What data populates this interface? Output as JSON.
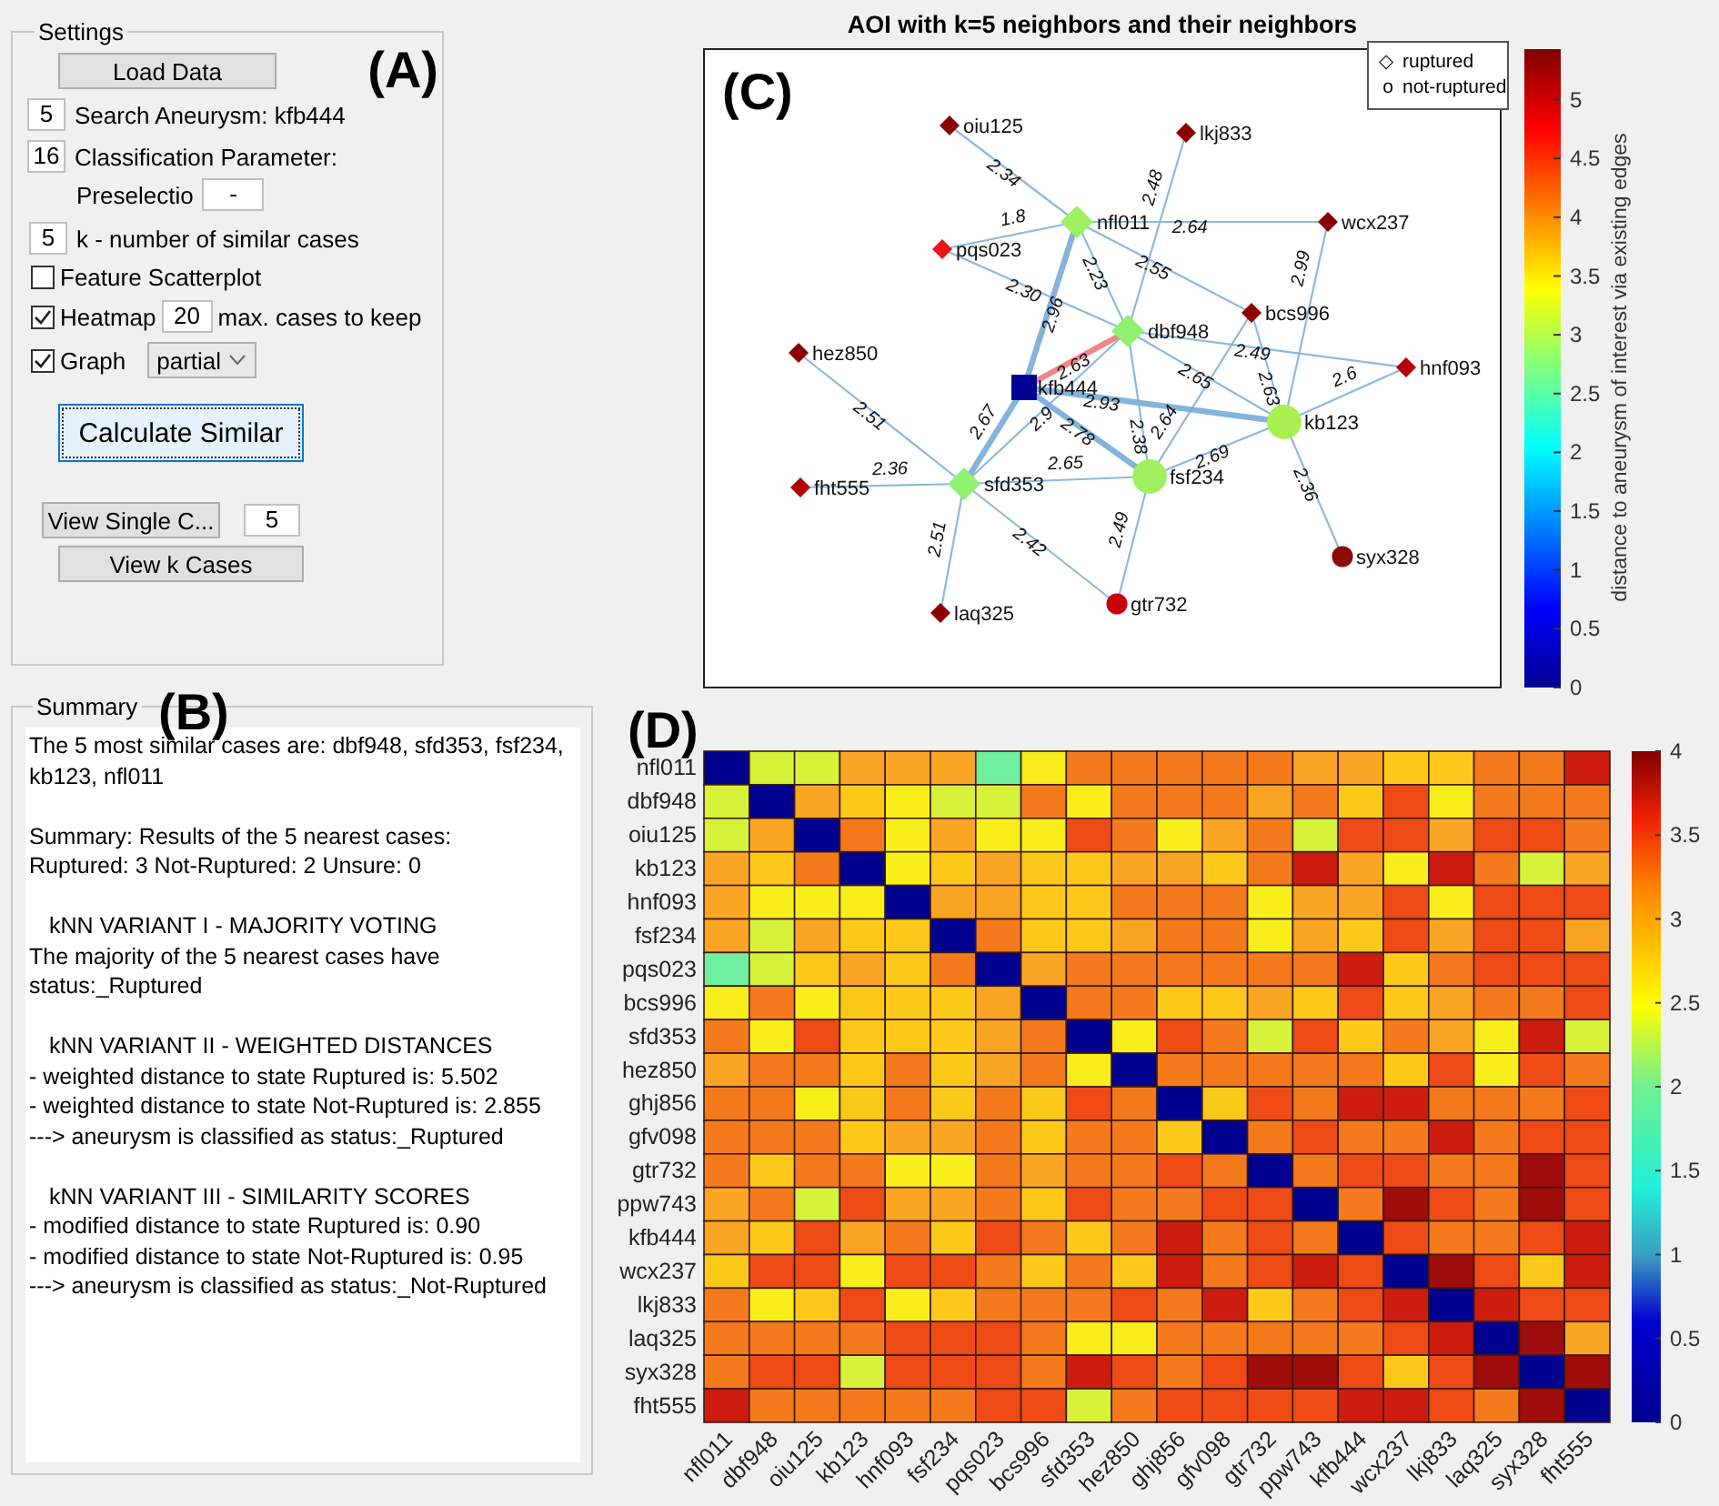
{
  "settings": {
    "title": "Settings",
    "tag": "(A)",
    "load_button": "Load Data",
    "search": {
      "value": "5",
      "label": "Search Aneurysm: kfb444"
    },
    "classification": {
      "value": "16",
      "label": "Classification Parameter:",
      "sublabel": "Preselectio",
      "subvalue": "-"
    },
    "k": {
      "value": "5",
      "label": "k - number of similar cases"
    },
    "feature_scatterplot": {
      "label": "Feature Scatterplot",
      "checked": false
    },
    "heatmap": {
      "label": "Heatmap",
      "checked": true,
      "value": "20",
      "suffix": "max. cases to keep"
    },
    "graph": {
      "label": "Graph",
      "checked": true,
      "mode": "partial"
    },
    "calculate_button": {
      "label": "Calculate Similar",
      "focused": true
    },
    "view_single": {
      "label": "View Single C...",
      "value": "5"
    },
    "view_k_button": "View k Cases"
  },
  "summary": {
    "title": "Summary",
    "tag": "(B)",
    "paragraphs": [
      [
        {
          "kind": "line",
          "text": "The 5 most similar cases are: dbf948, sfd353, fsf234, kb123, nfl011"
        }
      ],
      [
        {
          "kind": "line",
          "text": "Summary: Results of the 5 nearest cases:"
        },
        {
          "kind": "line",
          "text": "Ruptured: 3  Not-Ruptured: 2  Unsure: 0"
        }
      ],
      [
        {
          "kind": "heading",
          "text": "kNN VARIANT I - MAJORITY VOTING"
        },
        {
          "kind": "line",
          "text": "The majority of the 5 nearest cases have"
        },
        {
          "kind": "line",
          "text": "status:_Ruptured"
        }
      ],
      [
        {
          "kind": "heading",
          "text": "kNN VARIANT II - WEIGHTED DISTANCES"
        },
        {
          "kind": "line",
          "text": "- weighted distance to state Ruptured is: 5.502"
        },
        {
          "kind": "line",
          "text": "- weighted distance to state Not-Ruptured is: 2.855"
        },
        {
          "kind": "line",
          "text": "---> aneurysm is classified as status:_Ruptured"
        }
      ],
      [
        {
          "kind": "heading",
          "text": "kNN VARIANT III - SIMILARITY SCORES"
        },
        {
          "kind": "line",
          "text": "- modified distance to state Ruptured is: 0.90"
        },
        {
          "kind": "line",
          "text": "- modified distance to state Not-Ruptured is: 0.95"
        },
        {
          "kind": "line",
          "text": "---> aneurysm is classified as status:_Not-Ruptured"
        }
      ]
    ]
  },
  "graph": {
    "title": "AOI with k=5 neighbors and their neighbors",
    "tag": "(C)",
    "legend": [
      {
        "symbol": "◇",
        "label": "ruptured"
      },
      {
        "symbol": "o",
        "label": "not-ruptured"
      }
    ],
    "nodes": [
      {
        "label": "oiu125",
        "kind": "diamond",
        "color": "#8b0000"
      },
      {
        "label": "lkj833",
        "kind": "diamond",
        "color": "#8b0000"
      },
      {
        "label": "nfl011",
        "kind": "diamond",
        "color": "#9ef060"
      },
      {
        "label": "wcx237",
        "kind": "diamond",
        "color": "#8b0000"
      },
      {
        "label": "pqs023",
        "kind": "diamond",
        "color": "#e81818"
      },
      {
        "label": "dbf948",
        "kind": "diamond",
        "color": "#90f070"
      },
      {
        "label": "bcs996",
        "kind": "diamond",
        "color": "#8b0000"
      },
      {
        "label": "hez850",
        "kind": "diamond",
        "color": "#8b0000"
      },
      {
        "label": "hnf093",
        "kind": "diamond",
        "color": "#b00008"
      },
      {
        "label": "kfb444",
        "kind": "square",
        "color": "#000090"
      },
      {
        "label": "kb123",
        "kind": "circle",
        "color": "#a8f050"
      },
      {
        "label": "sfd353",
        "kind": "diamond",
        "color": "#90f070"
      },
      {
        "label": "fsf234",
        "kind": "circle",
        "color": "#a0f060"
      },
      {
        "label": "fht555",
        "kind": "diamond",
        "color": "#b00008"
      },
      {
        "label": "syx328",
        "kind": "circle",
        "color": "#8b0a0a"
      },
      {
        "label": "laq325",
        "kind": "diamond",
        "color": "#8b0000"
      },
      {
        "label": "gtr732",
        "kind": "circle",
        "color": "#c8000c"
      }
    ],
    "edges": [
      {
        "label": "2.34",
        "kind": "thin"
      },
      {
        "label": "1.8",
        "kind": "thin"
      },
      {
        "label": "2.64",
        "kind": "thin"
      },
      {
        "label": "2.48",
        "kind": "thin"
      },
      {
        "label": "2.55",
        "kind": "thin"
      },
      {
        "label": "2.23",
        "kind": "thin"
      },
      {
        "label": "2.30",
        "kind": "thin"
      },
      {
        "label": "2.96",
        "kind": "thick"
      },
      {
        "label": "2.63",
        "kind": "best"
      },
      {
        "label": "2.49",
        "kind": "thin"
      },
      {
        "label": "2.63",
        "kind": "thin"
      },
      {
        "label": "2.99",
        "kind": "thin"
      },
      {
        "label": "2.65",
        "kind": "thin"
      },
      {
        "label": "2.64",
        "kind": "thin"
      },
      {
        "label": "2.93",
        "kind": "thick"
      },
      {
        "label": "2.38",
        "kind": "thin"
      },
      {
        "label": "2.6",
        "kind": "thin"
      },
      {
        "label": "2.78",
        "kind": "thick"
      },
      {
        "label": "2.69",
        "kind": "thin"
      },
      {
        "label": "2.67",
        "kind": "thick"
      },
      {
        "label": "2.51",
        "kind": "thin"
      },
      {
        "label": "2.36",
        "kind": "thin"
      },
      {
        "label": "2.65",
        "kind": "thin"
      },
      {
        "label": "2.51",
        "kind": "thin"
      },
      {
        "label": "2.42",
        "kind": "thin"
      },
      {
        "label": "2.49",
        "kind": "thin"
      },
      {
        "label": "2.36",
        "kind": "thin"
      },
      {
        "label": "2.9",
        "kind": "thin"
      }
    ],
    "colorbar": {
      "label": "distance to aneurysm of interest via existing edges",
      "ticks": [
        "5",
        "4.5",
        "4",
        "3.5",
        "3",
        "2.5",
        "2",
        "1.5",
        "1",
        "0.5",
        "0"
      ]
    }
  },
  "heatmap": {
    "tag": "(D)",
    "columns": [
      "nfl011",
      "dbf948",
      "oiu125",
      "kb123",
      "hnf093",
      "fsf234",
      "pqs023",
      "bcs996",
      "sfd353",
      "hez850",
      "ghj856",
      "gfv098",
      "gtr732",
      "ppw743",
      "kfb444",
      "wcx237",
      "lkj833",
      "laq325",
      "syx328",
      "fht555"
    ],
    "rows": [
      {
        "label": "nfl011",
        "cells": [
          {
            "color": "#00008f"
          },
          {
            "color": "#d6f23a"
          },
          {
            "color": "#d6f23a"
          },
          {
            "color": "#fba524"
          },
          {
            "color": "#fba524"
          },
          {
            "color": "#fba524"
          },
          {
            "color": "#6ef0a0"
          },
          {
            "color": "#f7ee1c"
          },
          {
            "color": "#f57a1c"
          },
          {
            "color": "#f57a1c"
          },
          {
            "color": "#f57a1c"
          },
          {
            "color": "#f57a1c"
          },
          {
            "color": "#f57a1c"
          },
          {
            "color": "#fba524"
          },
          {
            "color": "#fba524"
          },
          {
            "color": "#fcc91a"
          },
          {
            "color": "#fcc91a"
          },
          {
            "color": "#f57a1c"
          },
          {
            "color": "#f57a1c"
          },
          {
            "color": "#cc1c10"
          }
        ]
      },
      {
        "label": "dbf948",
        "cells": [
          {
            "color": "#d6f23a"
          },
          {
            "color": "#00008f"
          },
          {
            "color": "#fba524"
          },
          {
            "color": "#fcc91a"
          },
          {
            "color": "#f7ee1c"
          },
          {
            "color": "#d6f23a"
          },
          {
            "color": "#d6f23a"
          },
          {
            "color": "#f57a1c"
          },
          {
            "color": "#f7ee1c"
          },
          {
            "color": "#f57a1c"
          },
          {
            "color": "#f57a1c"
          },
          {
            "color": "#f57a1c"
          },
          {
            "color": "#fba524"
          },
          {
            "color": "#f57a1c"
          },
          {
            "color": "#fcc91a"
          },
          {
            "color": "#ee4a16"
          },
          {
            "color": "#f7ee1c"
          },
          {
            "color": "#f57a1c"
          },
          {
            "color": "#f57a1c"
          },
          {
            "color": "#f57a1c"
          }
        ]
      },
      {
        "label": "oiu125",
        "cells": [
          {
            "color": "#d6f23a"
          },
          {
            "color": "#fba524"
          },
          {
            "color": "#00008f"
          },
          {
            "color": "#f57a1c"
          },
          {
            "color": "#f7ee1c"
          },
          {
            "color": "#fba524"
          },
          {
            "color": "#f7ee1c"
          },
          {
            "color": "#f7ee1c"
          },
          {
            "color": "#ee4a16"
          },
          {
            "color": "#f57a1c"
          },
          {
            "color": "#f7ee1c"
          },
          {
            "color": "#fba524"
          },
          {
            "color": "#f57a1c"
          },
          {
            "color": "#d6f23a"
          },
          {
            "color": "#ee4a16"
          },
          {
            "color": "#ee4a16"
          },
          {
            "color": "#fba524"
          },
          {
            "color": "#ee4a16"
          },
          {
            "color": "#ee4a16"
          },
          {
            "color": "#f57a1c"
          }
        ]
      },
      {
        "label": "kb123",
        "cells": [
          {
            "color": "#fba524"
          },
          {
            "color": "#fcc91a"
          },
          {
            "color": "#f57a1c"
          },
          {
            "color": "#00008f"
          },
          {
            "color": "#f7ee1c"
          },
          {
            "color": "#fcc91a"
          },
          {
            "color": "#fba524"
          },
          {
            "color": "#fcc91a"
          },
          {
            "color": "#fcc91a"
          },
          {
            "color": "#fba524"
          },
          {
            "color": "#fba524"
          },
          {
            "color": "#fcc91a"
          },
          {
            "color": "#f57a1c"
          },
          {
            "color": "#cc1c10"
          },
          {
            "color": "#fba524"
          },
          {
            "color": "#f7ee1c"
          },
          {
            "color": "#cc1c10"
          },
          {
            "color": "#f57a1c"
          },
          {
            "color": "#d6f23a"
          },
          {
            "color": "#fba524"
          }
        ]
      },
      {
        "label": "hnf093",
        "cells": [
          {
            "color": "#fba524"
          },
          {
            "color": "#f7ee1c"
          },
          {
            "color": "#f7ee1c"
          },
          {
            "color": "#f7ee1c"
          },
          {
            "color": "#00008f"
          },
          {
            "color": "#fba524"
          },
          {
            "color": "#fba524"
          },
          {
            "color": "#fcc91a"
          },
          {
            "color": "#fcc91a"
          },
          {
            "color": "#f57a1c"
          },
          {
            "color": "#f57a1c"
          },
          {
            "color": "#f57a1c"
          },
          {
            "color": "#f7ee1c"
          },
          {
            "color": "#fba524"
          },
          {
            "color": "#fba524"
          },
          {
            "color": "#ee4a16"
          },
          {
            "color": "#f7ee1c"
          },
          {
            "color": "#ee4a16"
          },
          {
            "color": "#ee4a16"
          },
          {
            "color": "#ee4a16"
          }
        ]
      },
      {
        "label": "fsf234",
        "cells": [
          {
            "color": "#fba524"
          },
          {
            "color": "#d6f23a"
          },
          {
            "color": "#fba524"
          },
          {
            "color": "#fcc91a"
          },
          {
            "color": "#fcc91a"
          },
          {
            "color": "#00008f"
          },
          {
            "color": "#f57a1c"
          },
          {
            "color": "#fcc91a"
          },
          {
            "color": "#fcc91a"
          },
          {
            "color": "#fba524"
          },
          {
            "color": "#f57a1c"
          },
          {
            "color": "#f57a1c"
          },
          {
            "color": "#f7ee1c"
          },
          {
            "color": "#fba524"
          },
          {
            "color": "#fcc91a"
          },
          {
            "color": "#ee4a16"
          },
          {
            "color": "#fba524"
          },
          {
            "color": "#ee4a16"
          },
          {
            "color": "#ee4a16"
          },
          {
            "color": "#fba524"
          }
        ]
      },
      {
        "label": "pqs023",
        "cells": [
          {
            "color": "#6ef0a0"
          },
          {
            "color": "#d6f23a"
          },
          {
            "color": "#fcc91a"
          },
          {
            "color": "#fba524"
          },
          {
            "color": "#fcc91a"
          },
          {
            "color": "#f57a1c"
          },
          {
            "color": "#00008f"
          },
          {
            "color": "#fba524"
          },
          {
            "color": "#f57a1c"
          },
          {
            "color": "#f57a1c"
          },
          {
            "color": "#f57a1c"
          },
          {
            "color": "#f57a1c"
          },
          {
            "color": "#f57a1c"
          },
          {
            "color": "#f57a1c"
          },
          {
            "color": "#cc1c10"
          },
          {
            "color": "#fcc91a"
          },
          {
            "color": "#f57a1c"
          },
          {
            "color": "#ee4a16"
          },
          {
            "color": "#ee4a16"
          },
          {
            "color": "#ee4a16"
          }
        ]
      },
      {
        "label": "bcs996",
        "cells": [
          {
            "color": "#f7ee1c"
          },
          {
            "color": "#f57a1c"
          },
          {
            "color": "#f7ee1c"
          },
          {
            "color": "#fcc91a"
          },
          {
            "color": "#fcc91a"
          },
          {
            "color": "#fcc91a"
          },
          {
            "color": "#fba524"
          },
          {
            "color": "#00008f"
          },
          {
            "color": "#f57a1c"
          },
          {
            "color": "#f57a1c"
          },
          {
            "color": "#fcc91a"
          },
          {
            "color": "#fcc91a"
          },
          {
            "color": "#fba524"
          },
          {
            "color": "#fcc91a"
          },
          {
            "color": "#ee4a16"
          },
          {
            "color": "#fcc91a"
          },
          {
            "color": "#fba524"
          },
          {
            "color": "#f57a1c"
          },
          {
            "color": "#f57a1c"
          },
          {
            "color": "#ee4a16"
          }
        ]
      },
      {
        "label": "sfd353",
        "cells": [
          {
            "color": "#f57a1c"
          },
          {
            "color": "#f7ee1c"
          },
          {
            "color": "#ee4a16"
          },
          {
            "color": "#fcc91a"
          },
          {
            "color": "#fcc91a"
          },
          {
            "color": "#fcc91a"
          },
          {
            "color": "#fba524"
          },
          {
            "color": "#f57a1c"
          },
          {
            "color": "#00008f"
          },
          {
            "color": "#f7ee1c"
          },
          {
            "color": "#ee4a16"
          },
          {
            "color": "#f57a1c"
          },
          {
            "color": "#d6f23a"
          },
          {
            "color": "#ee4a16"
          },
          {
            "color": "#fcc91a"
          },
          {
            "color": "#f57a1c"
          },
          {
            "color": "#fba524"
          },
          {
            "color": "#f7ee1c"
          },
          {
            "color": "#cc1c10"
          },
          {
            "color": "#d6f23a"
          }
        ]
      },
      {
        "label": "hez850",
        "cells": [
          {
            "color": "#fba524"
          },
          {
            "color": "#f57a1c"
          },
          {
            "color": "#f57a1c"
          },
          {
            "color": "#fcc91a"
          },
          {
            "color": "#f57a1c"
          },
          {
            "color": "#fcc91a"
          },
          {
            "color": "#fba524"
          },
          {
            "color": "#f57a1c"
          },
          {
            "color": "#f7ee1c"
          },
          {
            "color": "#00008f"
          },
          {
            "color": "#f57a1c"
          },
          {
            "color": "#f57a1c"
          },
          {
            "color": "#f57a1c"
          },
          {
            "color": "#f57a1c"
          },
          {
            "color": "#f57a1c"
          },
          {
            "color": "#fcc91a"
          },
          {
            "color": "#ee4a16"
          },
          {
            "color": "#f7ee1c"
          },
          {
            "color": "#ee4a16"
          },
          {
            "color": "#f57a1c"
          }
        ]
      },
      {
        "label": "ghj856",
        "cells": [
          {
            "color": "#f57a1c"
          },
          {
            "color": "#f57a1c"
          },
          {
            "color": "#f7ee1c"
          },
          {
            "color": "#fcc91a"
          },
          {
            "color": "#f57a1c"
          },
          {
            "color": "#fcc91a"
          },
          {
            "color": "#f57a1c"
          },
          {
            "color": "#fcc91a"
          },
          {
            "color": "#ee4a16"
          },
          {
            "color": "#f57a1c"
          },
          {
            "color": "#00008f"
          },
          {
            "color": "#fcc91a"
          },
          {
            "color": "#ee4a16"
          },
          {
            "color": "#f57a1c"
          },
          {
            "color": "#cc1c10"
          },
          {
            "color": "#cc1c10"
          },
          {
            "color": "#f57a1c"
          },
          {
            "color": "#f57a1c"
          },
          {
            "color": "#f57a1c"
          },
          {
            "color": "#ee4a16"
          }
        ]
      },
      {
        "label": "gfv098",
        "cells": [
          {
            "color": "#f57a1c"
          },
          {
            "color": "#f57a1c"
          },
          {
            "color": "#f57a1c"
          },
          {
            "color": "#fcc91a"
          },
          {
            "color": "#fba524"
          },
          {
            "color": "#fba524"
          },
          {
            "color": "#f57a1c"
          },
          {
            "color": "#fcc91a"
          },
          {
            "color": "#f57a1c"
          },
          {
            "color": "#f57a1c"
          },
          {
            "color": "#fcc91a"
          },
          {
            "color": "#00008f"
          },
          {
            "color": "#f57a1c"
          },
          {
            "color": "#ee4a16"
          },
          {
            "color": "#f57a1c"
          },
          {
            "color": "#f57a1c"
          },
          {
            "color": "#cc1c10"
          },
          {
            "color": "#f57a1c"
          },
          {
            "color": "#ee4a16"
          },
          {
            "color": "#ee4a16"
          }
        ]
      },
      {
        "label": "gtr732",
        "cells": [
          {
            "color": "#f57a1c"
          },
          {
            "color": "#fcc91a"
          },
          {
            "color": "#f57a1c"
          },
          {
            "color": "#f57a1c"
          },
          {
            "color": "#f7ee1c"
          },
          {
            "color": "#f7ee1c"
          },
          {
            "color": "#f57a1c"
          },
          {
            "color": "#fba524"
          },
          {
            "color": "#f57a1c"
          },
          {
            "color": "#f57a1c"
          },
          {
            "color": "#ee4a16"
          },
          {
            "color": "#f57a1c"
          },
          {
            "color": "#00008f"
          },
          {
            "color": "#f57a1c"
          },
          {
            "color": "#ee4a16"
          },
          {
            "color": "#ee4a16"
          },
          {
            "color": "#f57a1c"
          },
          {
            "color": "#f57a1c"
          },
          {
            "color": "#9e0c0c"
          },
          {
            "color": "#ee4a16"
          }
        ]
      },
      {
        "label": "ppw743",
        "cells": [
          {
            "color": "#fba524"
          },
          {
            "color": "#f57a1c"
          },
          {
            "color": "#d6f23a"
          },
          {
            "color": "#ee4a16"
          },
          {
            "color": "#fba524"
          },
          {
            "color": "#fba524"
          },
          {
            "color": "#f57a1c"
          },
          {
            "color": "#fcc91a"
          },
          {
            "color": "#ee4a16"
          },
          {
            "color": "#f57a1c"
          },
          {
            "color": "#f57a1c"
          },
          {
            "color": "#ee4a16"
          },
          {
            "color": "#ee4a16"
          },
          {
            "color": "#00008f"
          },
          {
            "color": "#f57a1c"
          },
          {
            "color": "#9e0c0c"
          },
          {
            "color": "#ee4a16"
          },
          {
            "color": "#f57a1c"
          },
          {
            "color": "#9e0c0c"
          },
          {
            "color": "#ee4a16"
          }
        ]
      },
      {
        "label": "kfb444",
        "cells": [
          {
            "color": "#fba524"
          },
          {
            "color": "#fcc91a"
          },
          {
            "color": "#ee4a16"
          },
          {
            "color": "#fba524"
          },
          {
            "color": "#f57a1c"
          },
          {
            "color": "#fcc91a"
          },
          {
            "color": "#ee4a16"
          },
          {
            "color": "#f57a1c"
          },
          {
            "color": "#fcc91a"
          },
          {
            "color": "#f57a1c"
          },
          {
            "color": "#cc1c10"
          },
          {
            "color": "#f57a1c"
          },
          {
            "color": "#ee4a16"
          },
          {
            "color": "#f57a1c"
          },
          {
            "color": "#00008f"
          },
          {
            "color": "#ee4a16"
          },
          {
            "color": "#f57a1c"
          },
          {
            "color": "#f57a1c"
          },
          {
            "color": "#ee4a16"
          },
          {
            "color": "#cc1c10"
          }
        ]
      },
      {
        "label": "wcx237",
        "cells": [
          {
            "color": "#fcc91a"
          },
          {
            "color": "#ee4a16"
          },
          {
            "color": "#ee4a16"
          },
          {
            "color": "#f7ee1c"
          },
          {
            "color": "#ee4a16"
          },
          {
            "color": "#ee4a16"
          },
          {
            "color": "#f57a1c"
          },
          {
            "color": "#fcc91a"
          },
          {
            "color": "#f57a1c"
          },
          {
            "color": "#fcc91a"
          },
          {
            "color": "#cc1c10"
          },
          {
            "color": "#f57a1c"
          },
          {
            "color": "#ee4a16"
          },
          {
            "color": "#cc1c10"
          },
          {
            "color": "#ee4a16"
          },
          {
            "color": "#00008f"
          },
          {
            "color": "#9e0c0c"
          },
          {
            "color": "#ee4a16"
          },
          {
            "color": "#fcc91a"
          },
          {
            "color": "#cc1c10"
          }
        ]
      },
      {
        "label": "lkj833",
        "cells": [
          {
            "color": "#f57a1c"
          },
          {
            "color": "#f7ee1c"
          },
          {
            "color": "#fcc91a"
          },
          {
            "color": "#ee4a16"
          },
          {
            "color": "#f7ee1c"
          },
          {
            "color": "#fcc91a"
          },
          {
            "color": "#f57a1c"
          },
          {
            "color": "#f57a1c"
          },
          {
            "color": "#f57a1c"
          },
          {
            "color": "#ee4a16"
          },
          {
            "color": "#f57a1c"
          },
          {
            "color": "#cc1c10"
          },
          {
            "color": "#fcc91a"
          },
          {
            "color": "#f57a1c"
          },
          {
            "color": "#ee4a16"
          },
          {
            "color": "#cc1c10"
          },
          {
            "color": "#00008f"
          },
          {
            "color": "#cc1c10"
          },
          {
            "color": "#ee4a16"
          },
          {
            "color": "#ee4a16"
          }
        ]
      },
      {
        "label": "laq325",
        "cells": [
          {
            "color": "#f57a1c"
          },
          {
            "color": "#f57a1c"
          },
          {
            "color": "#f57a1c"
          },
          {
            "color": "#f57a1c"
          },
          {
            "color": "#ee4a16"
          },
          {
            "color": "#ee4a16"
          },
          {
            "color": "#ee4a16"
          },
          {
            "color": "#f57a1c"
          },
          {
            "color": "#f7ee1c"
          },
          {
            "color": "#f7ee1c"
          },
          {
            "color": "#f57a1c"
          },
          {
            "color": "#f57a1c"
          },
          {
            "color": "#f57a1c"
          },
          {
            "color": "#f57a1c"
          },
          {
            "color": "#f57a1c"
          },
          {
            "color": "#ee4a16"
          },
          {
            "color": "#cc1c10"
          },
          {
            "color": "#00008f"
          },
          {
            "color": "#9e0c0c"
          },
          {
            "color": "#fba524"
          }
        ]
      },
      {
        "label": "syx328",
        "cells": [
          {
            "color": "#f57a1c"
          },
          {
            "color": "#ee4a16"
          },
          {
            "color": "#ee4a16"
          },
          {
            "color": "#d6f23a"
          },
          {
            "color": "#ee4a16"
          },
          {
            "color": "#ee4a16"
          },
          {
            "color": "#ee4a16"
          },
          {
            "color": "#f57a1c"
          },
          {
            "color": "#cc1c10"
          },
          {
            "color": "#ee4a16"
          },
          {
            "color": "#f57a1c"
          },
          {
            "color": "#ee4a16"
          },
          {
            "color": "#9e0c0c"
          },
          {
            "color": "#9e0c0c"
          },
          {
            "color": "#ee4a16"
          },
          {
            "color": "#fcc91a"
          },
          {
            "color": "#ee4a16"
          },
          {
            "color": "#9e0c0c"
          },
          {
            "color": "#00008f"
          },
          {
            "color": "#9e0c0c"
          }
        ]
      },
      {
        "label": "fht555",
        "cells": [
          {
            "color": "#cc1c10"
          },
          {
            "color": "#f57a1c"
          },
          {
            "color": "#f57a1c"
          },
          {
            "color": "#f57a1c"
          },
          {
            "color": "#f57a1c"
          },
          {
            "color": "#f57a1c"
          },
          {
            "color": "#ee4a16"
          },
          {
            "color": "#ee4a16"
          },
          {
            "color": "#d6f23a"
          },
          {
            "color": "#f57a1c"
          },
          {
            "color": "#ee4a16"
          },
          {
            "color": "#ee4a16"
          },
          {
            "color": "#ee4a16"
          },
          {
            "color": "#ee4a16"
          },
          {
            "color": "#cc1c10"
          },
          {
            "color": "#cc1c10"
          },
          {
            "color": "#ee4a16"
          },
          {
            "color": "#f57a1c"
          },
          {
            "color": "#9e0c0c"
          },
          {
            "color": "#00008f"
          }
        ]
      }
    ],
    "colorbar": {
      "ticks": [
        "4",
        "3.5",
        "3",
        "2.5",
        "2",
        "1.5",
        "1",
        "0.5",
        "0"
      ]
    }
  }
}
